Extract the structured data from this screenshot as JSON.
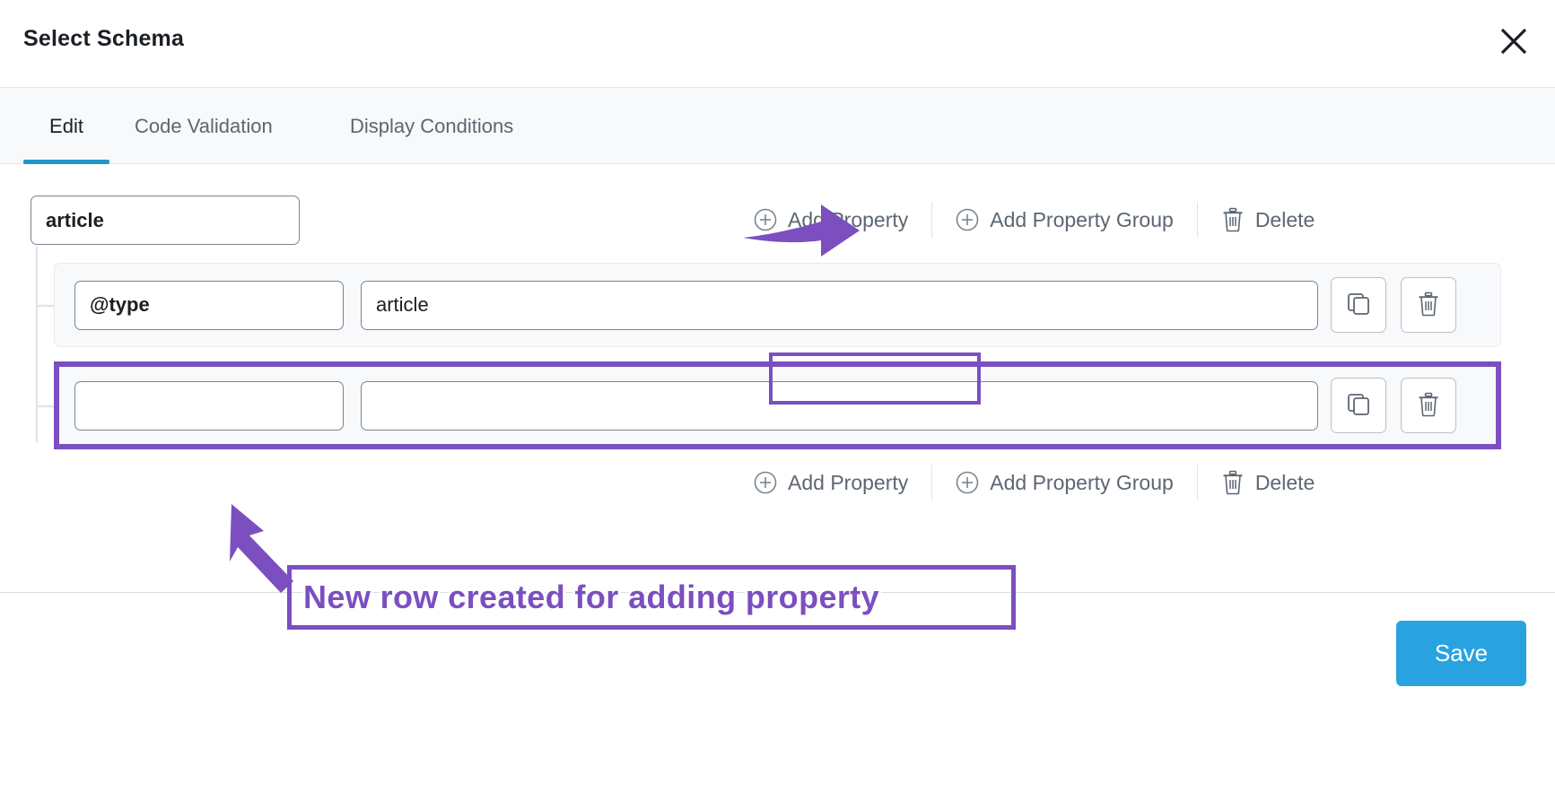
{
  "header": {
    "title": "Select Schema",
    "close_icon": "close-icon"
  },
  "tabs": [
    {
      "id": "edit",
      "label": "Edit",
      "active": true
    },
    {
      "id": "code-validation",
      "label": "Code Validation",
      "active": false
    },
    {
      "id": "display-conditions",
      "label": "Display Conditions",
      "active": false
    }
  ],
  "schema": {
    "root_name_value": "article",
    "root_name_placeholder": "",
    "rows": [
      {
        "key_value": "@type",
        "key_placeholder": "",
        "value_value": "article",
        "value_placeholder": "",
        "copy_icon": "copy-icon",
        "delete_icon": "trash-icon",
        "highlighted": false
      },
      {
        "key_value": "",
        "key_placeholder": "",
        "value_value": "",
        "value_placeholder": "",
        "copy_icon": "copy-icon",
        "delete_icon": "trash-icon",
        "highlighted": true
      }
    ]
  },
  "toolbar_top": {
    "add_property": "Add Property",
    "add_property_group": "Add Property Group",
    "delete": "Delete",
    "plus_icon": "plus-circle-icon",
    "trash_icon": "trash-icon"
  },
  "toolbar_bottom": {
    "add_property": "Add Property",
    "add_property_group": "Add Property Group",
    "delete": "Delete",
    "plus_icon": "plus-circle-icon",
    "trash_icon": "trash-icon"
  },
  "footer": {
    "save_label": "Save"
  },
  "annotations": {
    "callout_text": "New row created for adding property",
    "accent_color": "#7b4fc0",
    "arrow_to_add_property": "arrow-right-icon",
    "arrow_to_new_row": "arrow-up-left-icon"
  },
  "colors": {
    "tab_accent": "#2196c9",
    "save_button": "#29a3e0",
    "annotation_purple": "#7b4fc0",
    "panel_bg": "#f7f9fa",
    "text_primary": "#1b1f23",
    "text_secondary": "#5d6671"
  }
}
